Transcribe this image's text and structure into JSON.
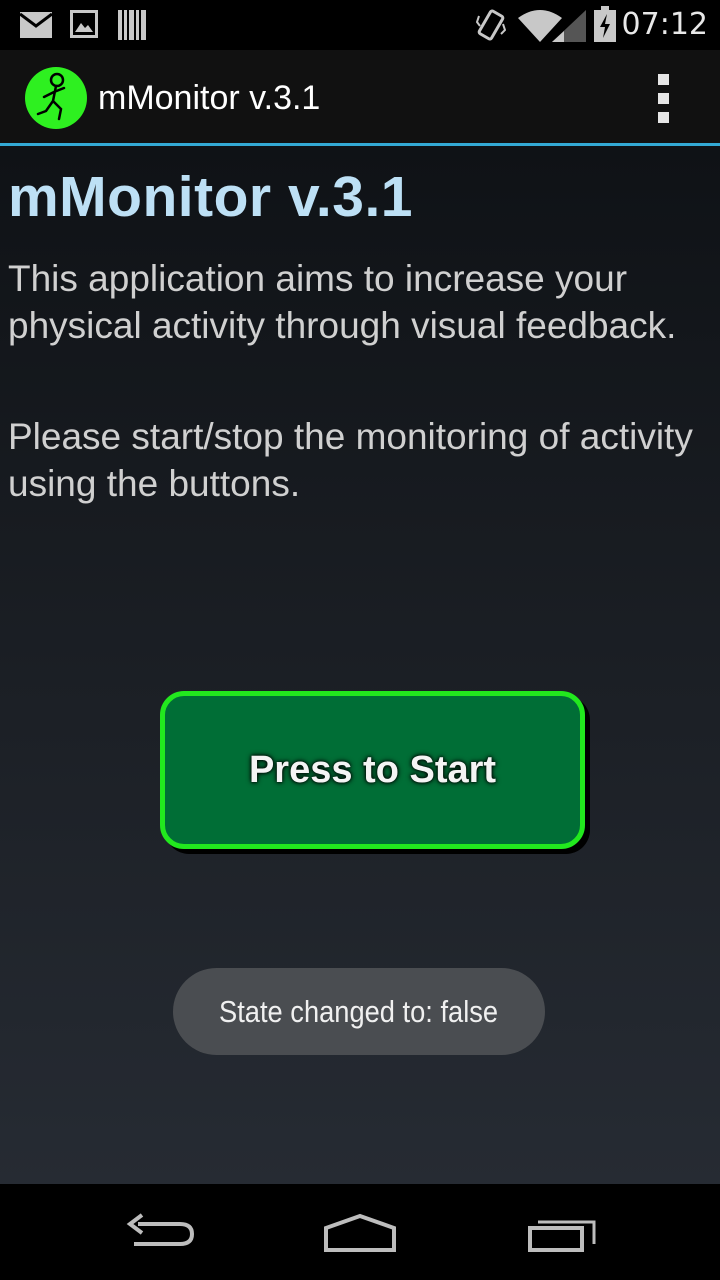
{
  "status_bar": {
    "time": "07:12",
    "icons": [
      "mail-icon",
      "image-icon",
      "barcode-icon",
      "vibrate-icon",
      "wifi-icon",
      "signal-icon",
      "battery-charging-icon"
    ]
  },
  "action_bar": {
    "title": "mMonitor v.3.1",
    "logo_icon": "running-figure-icon",
    "overflow_icon": "overflow-menu-icon"
  },
  "main": {
    "title": "mMonitor v.3.1",
    "paragraph_1": "This application aims to increase your physical activity through visual feedback.",
    "paragraph_2": "Please start/stop the monitoring of activity using the buttons.",
    "start_button_label": "Press to Start"
  },
  "toast": {
    "message": "State changed to: false"
  },
  "nav_bar": {
    "icons": [
      "back-icon",
      "home-icon",
      "recent-apps-icon"
    ]
  },
  "colors": {
    "accent": "#33a9d5",
    "title": "#bde0f5",
    "button_fill": "#006e36",
    "button_border": "#22e81e"
  }
}
